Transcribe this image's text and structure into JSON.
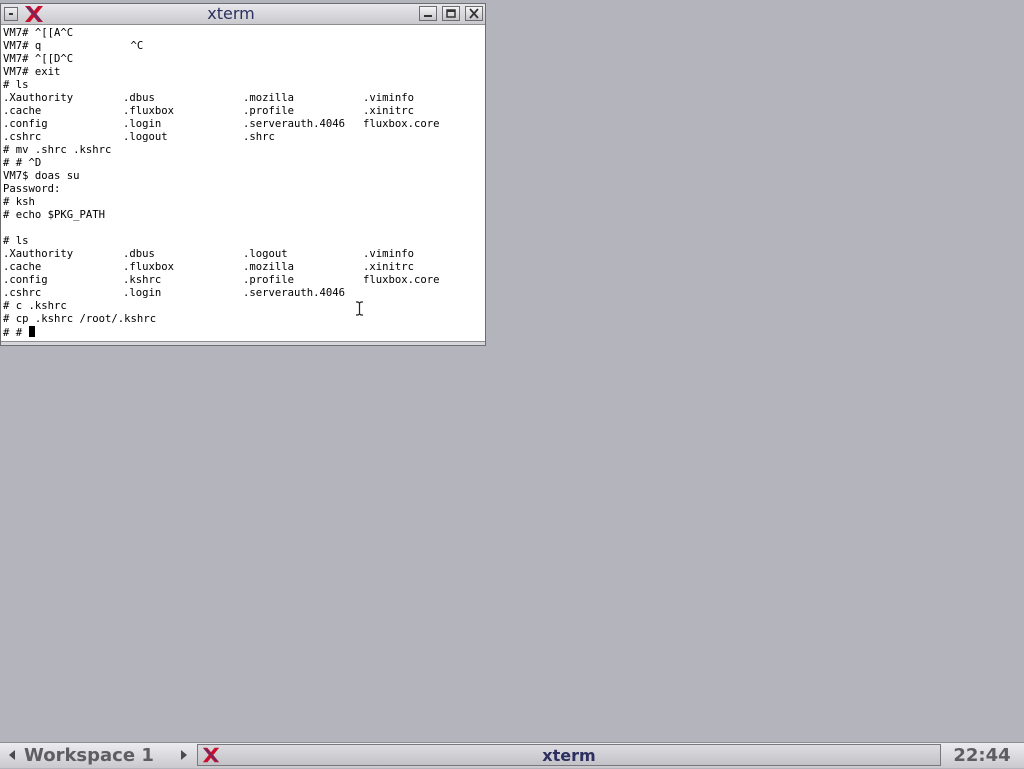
{
  "window": {
    "title": "xterm",
    "icon": "x-logo-icon"
  },
  "terminal": {
    "lines": [
      "VM7# ^[[A^C",
      "VM7# q              ^C",
      "VM7# ^[[D^C",
      "VM7# exit",
      "# ls",
      [
        "",
        ".Xauthority",
        ".dbus",
        ".mozilla",
        ".viminfo"
      ],
      [
        "",
        ".cache",
        ".fluxbox",
        ".profile",
        ".xinitrc"
      ],
      [
        "",
        ".config",
        ".login",
        ".serverauth.4046",
        "fluxbox.core"
      ],
      [
        "",
        ".cshrc",
        ".logout",
        ".shrc",
        ""
      ],
      "# mv .shrc .kshrc",
      "# # ^D",
      "VM7$ doas su",
      "Password:",
      "# ksh",
      "# echo $PKG_PATH",
      "",
      "# ls",
      [
        "",
        ".Xauthority",
        ".dbus",
        ".logout",
        ".viminfo"
      ],
      [
        "",
        ".cache",
        ".fluxbox",
        ".mozilla",
        ".xinitrc"
      ],
      [
        "",
        ".config",
        ".kshrc",
        ".profile",
        "fluxbox.core"
      ],
      [
        "",
        ".cshrc",
        ".login",
        ".serverauth.4046",
        ""
      ],
      "# c .kshrc",
      "# cp .kshrc /root/.kshrc",
      "# # "
    ]
  },
  "toolbar": {
    "workspace_name": "Workspace 1",
    "task_title": "xterm",
    "clock": "22:44",
    "prev_icon": "triangle-left-icon",
    "next_icon": "triangle-right-icon"
  },
  "colors": {
    "desktop": "#b4b4bc",
    "title_text": "#2c2f5f",
    "x_logo_red": "#c8102e",
    "x_logo_blue": "#1c3f94"
  }
}
